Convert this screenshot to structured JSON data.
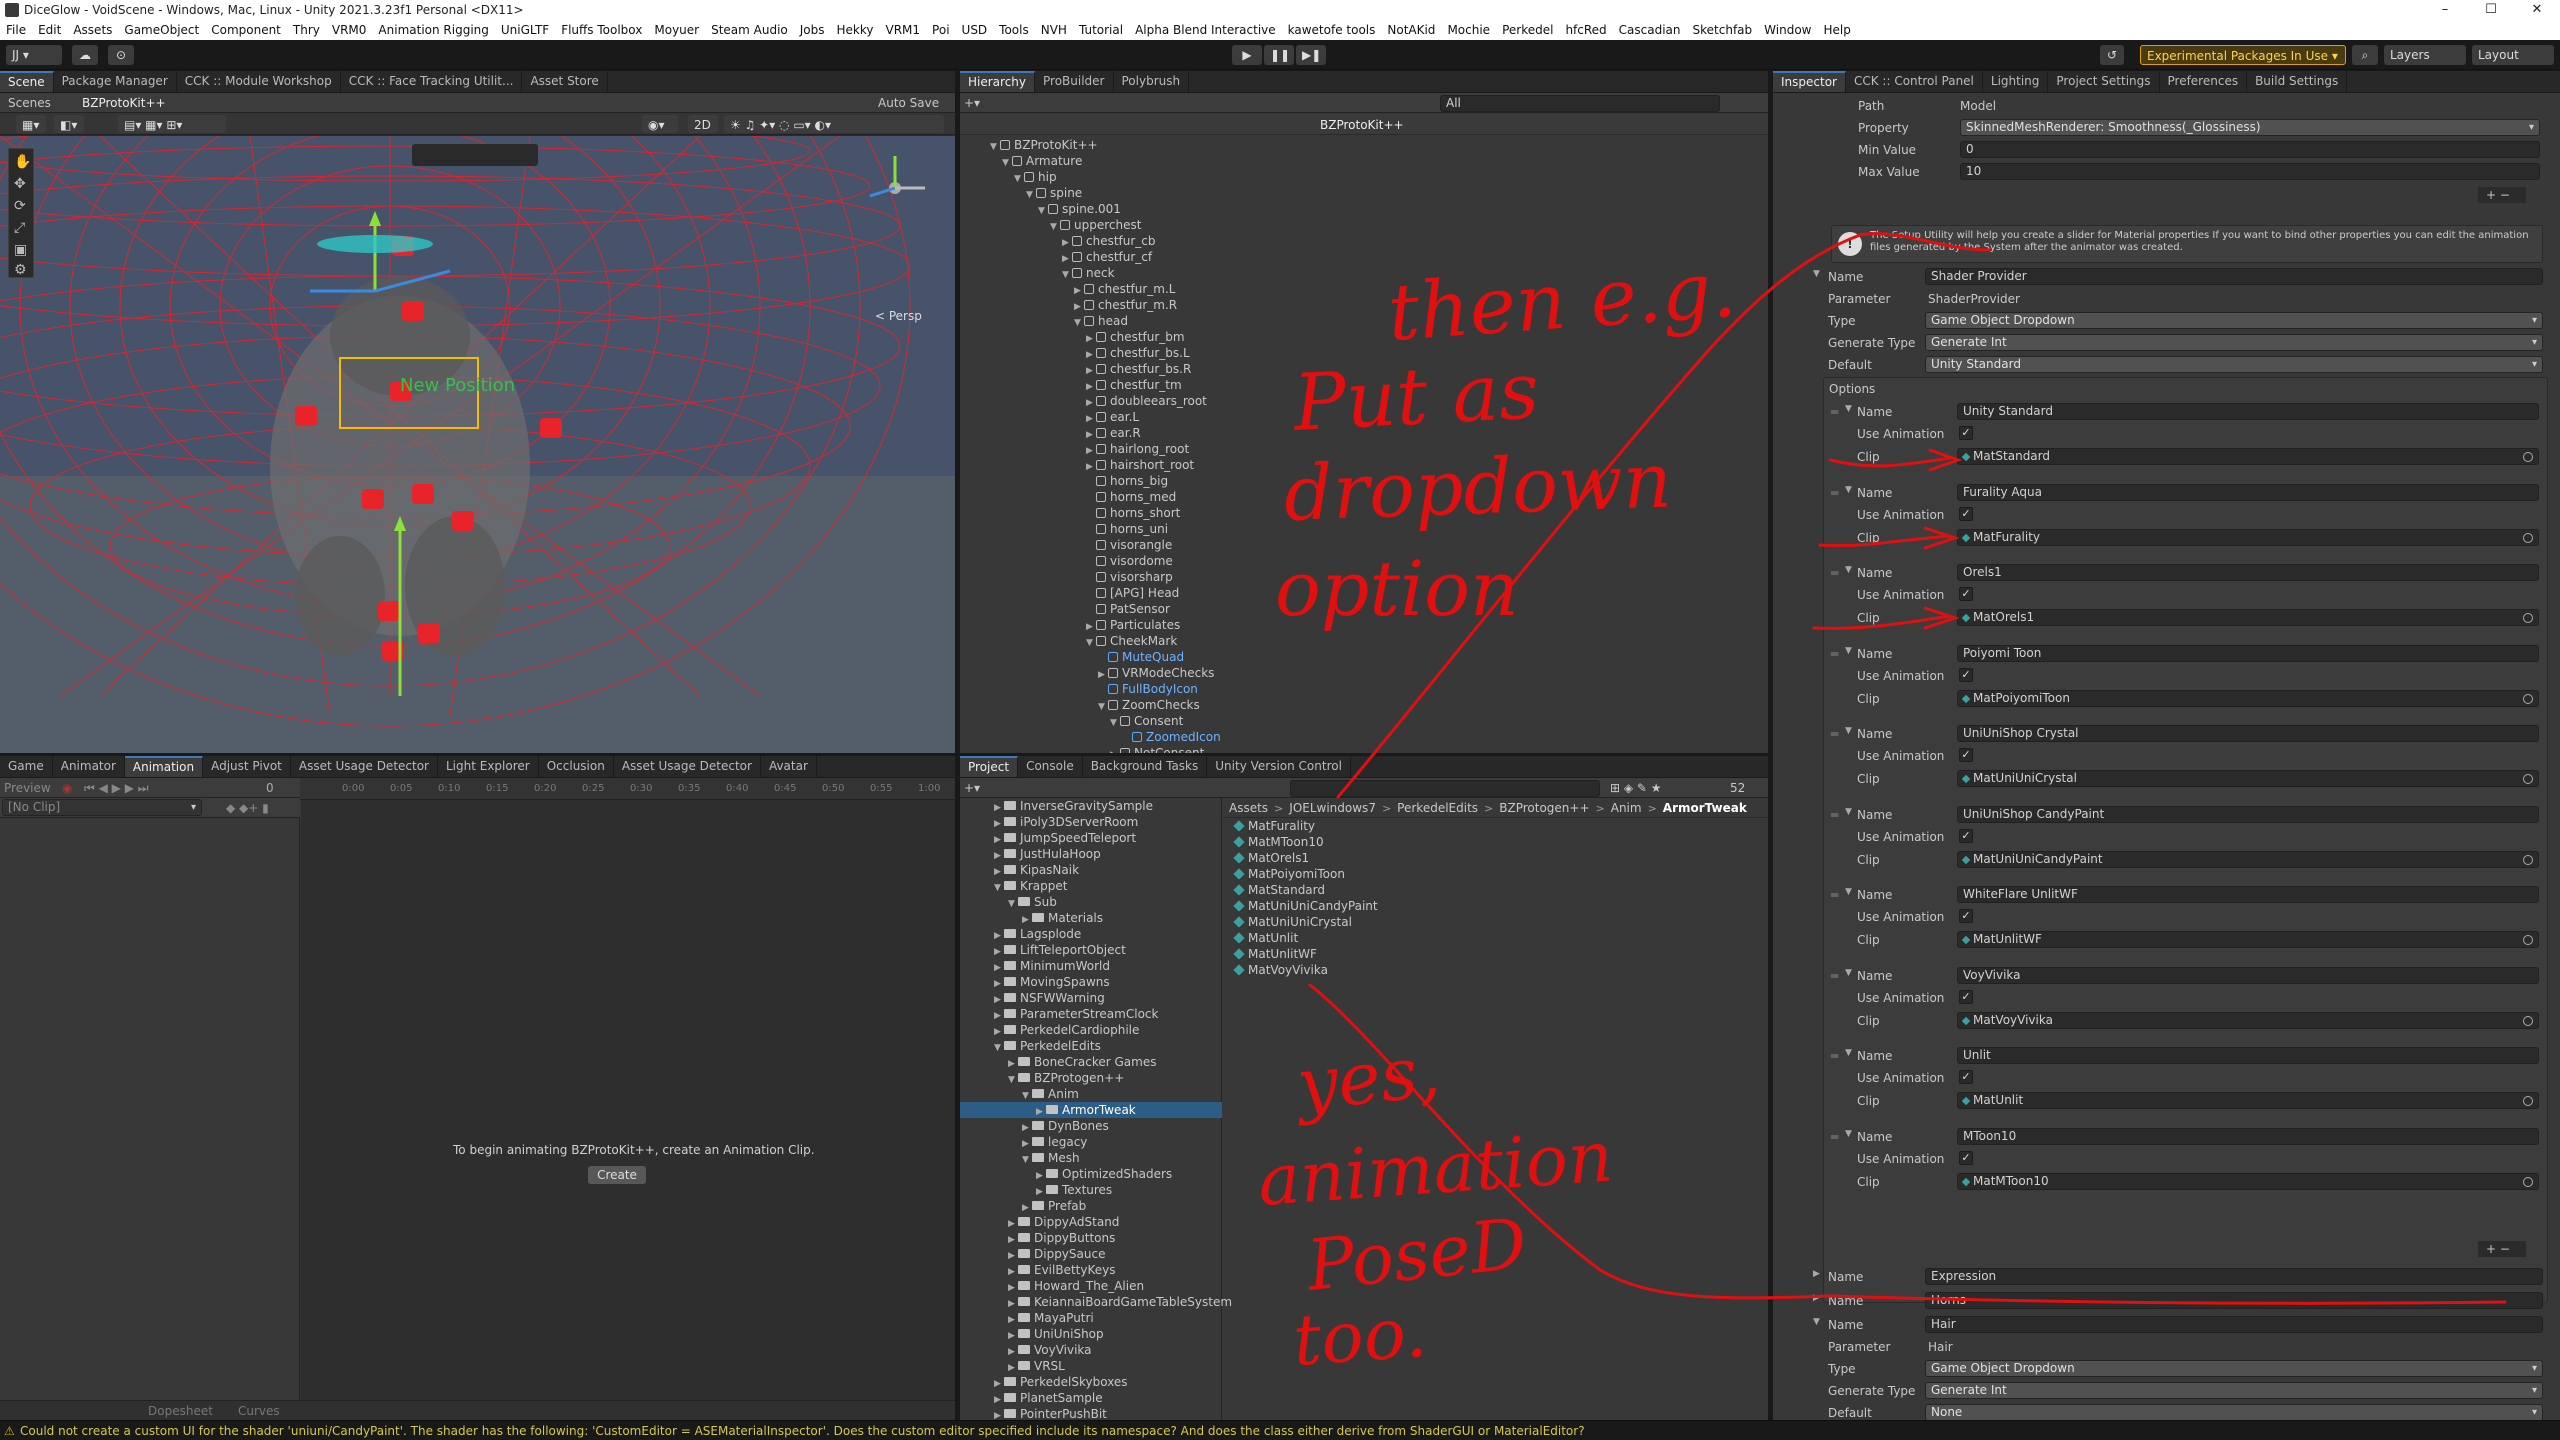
{
  "window": {
    "title": "DiceGlow - VoidScene - Windows, Mac, Linux - Unity 2021.3.23f1 Personal <DX11>",
    "minimize": "–",
    "maximize": "☐",
    "close": "✕"
  },
  "menu": [
    "File",
    "Edit",
    "Assets",
    "GameObject",
    "Component",
    "Thry",
    "VRM0",
    "Animation Rigging",
    "UniGLTF",
    "Fluffs Toolbox",
    "Moyuer",
    "Steam Audio",
    "Jobs",
    "Hekky",
    "VRM1",
    "Poi",
    "USD",
    "Tools",
    "NVH",
    "Tutorial",
    "Alpha Blend Interactive",
    "kawetofe tools",
    "NotAKid",
    "Mochie",
    "Perkedel",
    "hfcRed",
    "Cascadian",
    "Sketchfab",
    "Window",
    "Help"
  ],
  "toolbar": {
    "account": "JJ ▾",
    "experimental": "Experimental Packages In Use ▾",
    "layers": "Layers",
    "layout": "Layout"
  },
  "scene_panel": {
    "tabs": [
      "Scene",
      "Package Manager",
      "CCK :: Module Workshop",
      "CCK :: Face Tracking Utilit...",
      "Asset Store"
    ],
    "scenes_label": "Scenes",
    "object_label": "BZProtoKit++",
    "auto_save": "Auto Save",
    "persp": "< Persp",
    "handle_label": "New Position",
    "badge": "2D"
  },
  "hierarchy": {
    "tabs": [
      "Hierarchy",
      "ProBuilder",
      "Polybrush"
    ],
    "search_placeholder": "All",
    "root": "BZProtoKit++",
    "items": [
      {
        "label": "BZProtoKit++",
        "d": 0,
        "open": true
      },
      {
        "label": "Armature",
        "d": 1,
        "open": true
      },
      {
        "label": "hip",
        "d": 2,
        "open": true
      },
      {
        "label": "spine",
        "d": 3,
        "open": true
      },
      {
        "label": "spine.001",
        "d": 4,
        "open": true
      },
      {
        "label": "upperchest",
        "d": 5,
        "open": true
      },
      {
        "label": "chestfur_cb",
        "d": 6,
        "open": false
      },
      {
        "label": "chestfur_cf",
        "d": 6,
        "open": false
      },
      {
        "label": "neck",
        "d": 6,
        "open": true
      },
      {
        "label": "chestfur_m.L",
        "d": 7,
        "open": false
      },
      {
        "label": "chestfur_m.R",
        "d": 7,
        "open": false
      },
      {
        "label": "head",
        "d": 7,
        "open": true
      },
      {
        "label": "chestfur_bm",
        "d": 8,
        "open": false
      },
      {
        "label": "chestfur_bs.L",
        "d": 8,
        "open": false
      },
      {
        "label": "chestfur_bs.R",
        "d": 8,
        "open": false
      },
      {
        "label": "chestfur_tm",
        "d": 8,
        "open": false
      },
      {
        "label": "doubleears_root",
        "d": 8,
        "open": false
      },
      {
        "label": "ear.L",
        "d": 8,
        "open": false
      },
      {
        "label": "ear.R",
        "d": 8,
        "open": false
      },
      {
        "label": "hairlong_root",
        "d": 8,
        "open": false
      },
      {
        "label": "hairshort_root",
        "d": 8,
        "open": false
      },
      {
        "label": "horns_big",
        "d": 8,
        "open": null
      },
      {
        "label": "horns_med",
        "d": 8,
        "open": null
      },
      {
        "label": "horns_short",
        "d": 8,
        "open": null
      },
      {
        "label": "horns_uni",
        "d": 8,
        "open": null
      },
      {
        "label": "visorangle",
        "d": 8,
        "open": null
      },
      {
        "label": "visordome",
        "d": 8,
        "open": null
      },
      {
        "label": "visorsharp",
        "d": 8,
        "open": null
      },
      {
        "label": "[APG] Head",
        "d": 8,
        "open": null
      },
      {
        "label": "PatSensor",
        "d": 8,
        "open": null
      },
      {
        "label": "Particulates",
        "d": 8,
        "open": false
      },
      {
        "label": "CheekMark",
        "d": 8,
        "open": true
      },
      {
        "label": "MuteQuad",
        "d": 9,
        "open": null,
        "blue": true
      },
      {
        "label": "VRModeChecks",
        "d": 9,
        "open": false
      },
      {
        "label": "FullBodyIcon",
        "d": 9,
        "open": null,
        "blue": true
      },
      {
        "label": "ZoomChecks",
        "d": 9,
        "open": true
      },
      {
        "label": "Consent",
        "d": 10,
        "open": true
      },
      {
        "label": "ZoomedIcon",
        "d": 11,
        "open": null,
        "blue": true
      },
      {
        "label": "NotConsent",
        "d": 10,
        "open": false
      }
    ]
  },
  "inspector": {
    "tabs": [
      "Inspector",
      "CCK :: Control Panel",
      "Lighting",
      "Project Settings",
      "Preferences",
      "Build Settings"
    ],
    "path_label": "Path",
    "path_value": "Model",
    "property_label": "Property",
    "property_value": "SkinnedMeshRenderer: Smoothness(_Glossiness)",
    "min_label": "Min Value",
    "min_value": "0",
    "max_label": "Max Value",
    "max_value": "10",
    "info": "The Setup Utility will help you create a slider for Material properties If you want to bind other properties you can edit the animation files generated by the System after the animator was created.",
    "labels": {
      "name": "Name",
      "parameter": "Parameter",
      "type": "Type",
      "generate_type": "Generate Type",
      "default": "Default",
      "options": "Options",
      "use_animation": "Use Animation",
      "clip": "Clip"
    },
    "shader": {
      "name": "Shader Provider",
      "parameter": "ShaderProvider",
      "type": "Game Object Dropdown",
      "generate_type": "Generate Int",
      "default": "Unity Standard"
    },
    "options": [
      {
        "name": "Unity Standard",
        "clip": "MatStandard"
      },
      {
        "name": "Furality Aqua",
        "clip": "MatFurality"
      },
      {
        "name": "Orels1",
        "clip": "MatOrels1"
      },
      {
        "name": "Poiyomi Toon",
        "clip": "MatPoiyomiToon"
      },
      {
        "name": "UniUniShop Crystal",
        "clip": "MatUniUniCrystal"
      },
      {
        "name": "UniUniShop CandyPaint",
        "clip": "MatUniUniCandyPaint"
      },
      {
        "name": "WhiteFlare UnlitWF",
        "clip": "MatUnlitWF"
      },
      {
        "name": "VoyVivika",
        "clip": "MatVoyVivika"
      },
      {
        "name": "Unlit",
        "clip": "MatUnlit"
      },
      {
        "name": "MToon10",
        "clip": "MatMToon10"
      }
    ],
    "expression": "Expression",
    "horns": "Horns",
    "hair": {
      "name": "Hair",
      "parameter": "Hair",
      "type": "Game Object Dropdown",
      "generate_type": "Generate Int",
      "default": "None"
    },
    "plus": "+",
    "minus": "−"
  },
  "animation_panel": {
    "tabs": [
      "Game",
      "Animator",
      "Animation",
      "Adjust Pivot",
      "Asset Usage Detector",
      "Light Explorer",
      "Occlusion",
      "Asset Usage Detector",
      "Avatar"
    ],
    "preview": "Preview",
    "clip": "[No Clip]",
    "frame": "0",
    "ticks": [
      "0:00",
      "0:05",
      "0:10",
      "0:15",
      "0:20",
      "0:25",
      "0:30",
      "0:35",
      "0:40",
      "0:45",
      "0:50",
      "0:55",
      "1:00"
    ],
    "message": "To begin animating BZProtoKit++, create an Animation Clip.",
    "create": "Create",
    "dopesheet": "Dopesheet",
    "curves": "Curves"
  },
  "project": {
    "tabs": [
      "Project",
      "Console",
      "Background Tasks",
      "Unity Version Control"
    ],
    "count": "52",
    "breadcrumb": [
      "Assets",
      "JOELwindows7",
      "PerkedelEdits",
      "BZProtogen++",
      "Anim",
      "ArmorTweak"
    ],
    "folders": [
      {
        "label": "InverseGravitySample",
        "d": 1
      },
      {
        "label": "iPoly3DServerRoom",
        "d": 1
      },
      {
        "label": "JumpSpeedTeleport",
        "d": 1
      },
      {
        "label": "JustHulaHoop",
        "d": 1
      },
      {
        "label": "KipasNaik",
        "d": 1
      },
      {
        "label": "Krappet",
        "d": 1,
        "open": true
      },
      {
        "label": "Sub",
        "d": 2,
        "open": true
      },
      {
        "label": "Materials",
        "d": 3
      },
      {
        "label": "Lagsplode",
        "d": 1
      },
      {
        "label": "LiftTeleportObject",
        "d": 1
      },
      {
        "label": "MinimumWorld",
        "d": 1
      },
      {
        "label": "MovingSpawns",
        "d": 1
      },
      {
        "label": "NSFWWarning",
        "d": 1
      },
      {
        "label": "ParameterStreamClock",
        "d": 1
      },
      {
        "label": "PerkedelCardiophile",
        "d": 1
      },
      {
        "label": "PerkedelEdits",
        "d": 1,
        "open": true
      },
      {
        "label": "BoneCracker Games",
        "d": 2
      },
      {
        "label": "BZProtogen++",
        "d": 2,
        "open": true
      },
      {
        "label": "Anim",
        "d": 3,
        "open": true
      },
      {
        "label": "ArmorTweak",
        "d": 4,
        "selected": true
      },
      {
        "label": "DynBones",
        "d": 3
      },
      {
        "label": "legacy",
        "d": 3
      },
      {
        "label": "Mesh",
        "d": 3,
        "open": true
      },
      {
        "label": "OptimizedShaders",
        "d": 4
      },
      {
        "label": "Textures",
        "d": 4
      },
      {
        "label": "Prefab",
        "d": 3
      },
      {
        "label": "DippyAdStand",
        "d": 2
      },
      {
        "label": "DippyButtons",
        "d": 2
      },
      {
        "label": "DippySauce",
        "d": 2
      },
      {
        "label": "EvilBettyKeys",
        "d": 2
      },
      {
        "label": "Howard_The_Alien",
        "d": 2
      },
      {
        "label": "KeiannaiBoardGameTableSystem",
        "d": 2
      },
      {
        "label": "MayaPutri",
        "d": 2
      },
      {
        "label": "UniUniShop",
        "d": 2
      },
      {
        "label": "VoyVivika",
        "d": 2
      },
      {
        "label": "VRSL",
        "d": 2
      },
      {
        "label": "PerkedelSkyboxes",
        "d": 1
      },
      {
        "label": "PlanetSample",
        "d": 1
      },
      {
        "label": "PointerPushBit",
        "d": 1
      }
    ],
    "files": [
      "MatFurality",
      "MatMToon10",
      "MatOrels1",
      "MatPoiyomiToon",
      "MatStandard",
      "MatUniUniCandyPaint",
      "MatUniUniCrystal",
      "MatUnlit",
      "MatUnlitWF",
      "MatVoyVivika"
    ]
  },
  "status": "Could not create a custom UI for the shader 'uniuni/CandyPaint'. The shader has the following: 'CustomEditor = ASEMaterialInspector'. Does the custom editor specified include its namespace? And does the class either derive from ShaderGUI or MaterialEditor?",
  "annotations": {
    "line1": [
      "then e.g.",
      "Put as",
      "dropdown",
      "option"
    ],
    "line2": [
      "yes,",
      "animation",
      "PoseD",
      "too."
    ],
    "color": "#e01010"
  }
}
